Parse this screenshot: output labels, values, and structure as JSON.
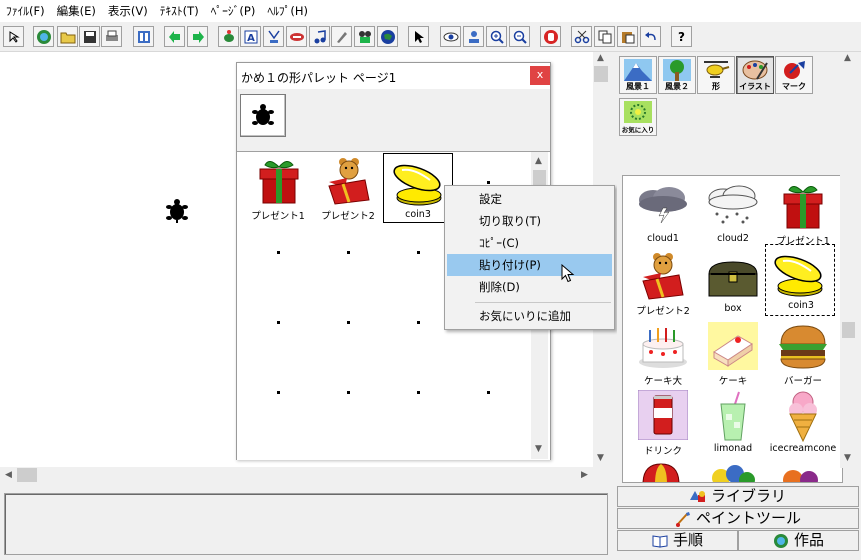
{
  "menubar": {
    "items": [
      "ﾌｧｲﾙ(F)",
      "編集(E)",
      "表示(V)",
      "ﾃｷｽﾄ(T)",
      "ﾍﾟｰｼﾞ(P)",
      "ﾍﾙﾌﾟ(H)"
    ]
  },
  "toolbar": {
    "help_label": "?"
  },
  "palette": {
    "title": "かめ１の形パレット ページ1",
    "close_label": "x",
    "items": [
      {
        "label": "プレゼント1"
      },
      {
        "label": "プレゼント2"
      },
      {
        "label": "coin3"
      }
    ]
  },
  "context_menu": {
    "items": [
      "設定",
      "切り取り(T)",
      "ｺﾋﾟｰ(C)",
      "貼り付け(P)",
      "削除(D)",
      "お気にいりに追加"
    ],
    "highlighted": "貼り付け(P)"
  },
  "library": {
    "categories": [
      "風景１",
      "風景２",
      "形",
      "イラスト",
      "マーク",
      "お気に入り"
    ],
    "active_category": "イラスト",
    "items": [
      "cloud1",
      "cloud2",
      "プレゼント1",
      "プレゼント2",
      "box",
      "coin3",
      "ケーキ大",
      "ケーキ",
      "バーガー",
      "ドリンク",
      "limonad",
      "icecreamcone"
    ]
  },
  "bottom_buttons": {
    "library": "ライブラリ",
    "paint_tool": "ペイントツール",
    "procedure": "手順",
    "works": "作品"
  },
  "colors": {
    "highlight": "#99c9ef",
    "close_button": "#e04343",
    "canvas": "#ffffff"
  }
}
